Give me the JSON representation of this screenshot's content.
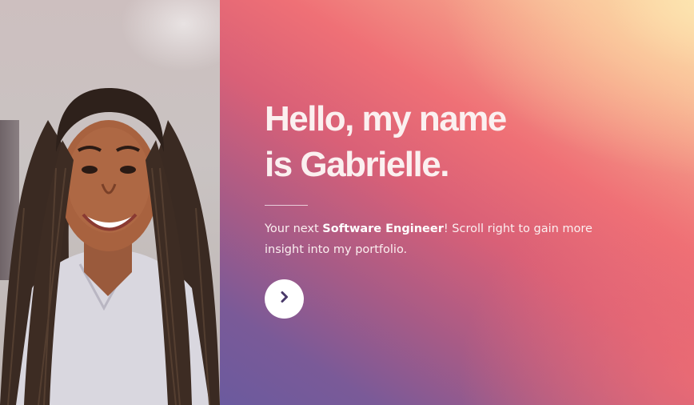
{
  "profile": {
    "photo_icon": "portrait-photo"
  },
  "hero": {
    "title_line1": "Hello, my name",
    "title_line2": "is Gabrielle.",
    "intro_before": "Your next ",
    "intro_bold": "Software Engineer",
    "intro_after": "! Scroll right to gain more insight into my portfolio.",
    "next_icon": "chevron-right-icon"
  },
  "colors": {
    "gradient_top": "#fbdcae",
    "gradient_mid": "#ef7076",
    "gradient_bottom": "#6b5a9e",
    "title_text": "#fbf0f0",
    "button_bg": "#ffffff",
    "chevron": "#4a3a6a"
  }
}
